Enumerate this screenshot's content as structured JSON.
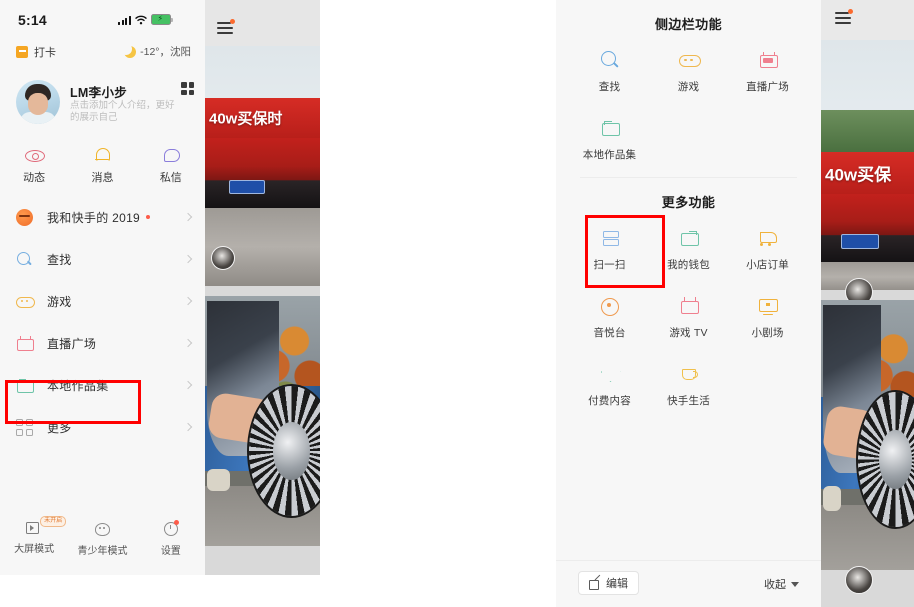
{
  "left_phone": {
    "status_bar": {
      "time": "5:14",
      "signal_icon": "signal-bars-icon",
      "wifi_icon": "wifi-icon",
      "battery_icon": "battery-charging-icon"
    },
    "checkin": {
      "label": "打卡",
      "icon": "calendar-check-icon",
      "weather_icon": "moon-icon",
      "weather": "-12°，沈阳"
    },
    "profile": {
      "name": "LM李小步",
      "intro": "点击添加个人介绍，更好的展示自己",
      "qr_icon": "qr-code-icon",
      "avatar": "user-avatar"
    },
    "actions": [
      {
        "label": "动态",
        "icon": "eye-icon",
        "color": "#e06a7a"
      },
      {
        "label": "消息",
        "icon": "bell-icon",
        "color": "#f0b429"
      },
      {
        "label": "私信",
        "icon": "chat-bubble-icon",
        "color": "#8a7ddb"
      }
    ],
    "menu": [
      {
        "label": "我和快手的 2019",
        "icon": "pumpkin-icon",
        "dot": true,
        "chevron": "chevron-right-icon"
      },
      {
        "label": "查找",
        "icon": "search-icon",
        "dot": false,
        "chevron": "chevron-right-icon"
      },
      {
        "label": "游戏",
        "icon": "game-icon",
        "dot": false,
        "chevron": "chevron-right-icon"
      },
      {
        "label": "直播广场",
        "icon": "live-icon",
        "dot": false,
        "chevron": "chevron-right-icon"
      },
      {
        "label": "本地作品集",
        "icon": "folder-icon",
        "dot": false,
        "chevron": "chevron-right-icon"
      },
      {
        "label": "更多",
        "icon": "grid-icon",
        "dot": false,
        "chevron": "chevron-right-icon",
        "highlighted": true
      }
    ],
    "bottom": [
      {
        "label": "大屏模式",
        "icon": "big-screen-icon",
        "badge": "未开启"
      },
      {
        "label": "青少年模式",
        "icon": "teen-mode-icon",
        "badge": ""
      },
      {
        "label": "设置",
        "icon": "gear-icon",
        "badge": ""
      }
    ],
    "video": {
      "menu_icon": "hamburger-menu-icon",
      "banner_text": "40w买保时"
    }
  },
  "right_phone": {
    "sidebar_section": {
      "title": "侧边栏功能"
    },
    "sidebar_items": [
      {
        "label": "查找",
        "icon": "search-icon"
      },
      {
        "label": "游戏",
        "icon": "game-icon"
      },
      {
        "label": "直播广场",
        "icon": "live-icon"
      },
      {
        "label": "本地作品集",
        "icon": "folder-icon"
      }
    ],
    "more_section": {
      "title": "更多功能"
    },
    "more_items": [
      {
        "label": "扫一扫",
        "icon": "scan-icon",
        "highlighted": true
      },
      {
        "label": "我的钱包",
        "icon": "wallet-icon"
      },
      {
        "label": "小店订单",
        "icon": "cart-icon"
      },
      {
        "label": "音悦台",
        "icon": "music-disc-icon"
      },
      {
        "label": "游戏 TV",
        "icon": "tv-icon"
      },
      {
        "label": "小剧场",
        "icon": "theater-screen-icon"
      },
      {
        "label": "付费内容",
        "icon": "diamond-icon"
      },
      {
        "label": "快手生活",
        "icon": "coffee-cup-icon"
      }
    ],
    "bottom_bar": {
      "edit_label": "编辑",
      "edit_icon": "edit-icon",
      "collapse_label": "收起",
      "collapse_icon": "caret-down-icon"
    },
    "video": {
      "menu_icon": "hamburger-menu-icon",
      "banner_text": "40w买保"
    }
  },
  "highlight_color": "#ff0000"
}
